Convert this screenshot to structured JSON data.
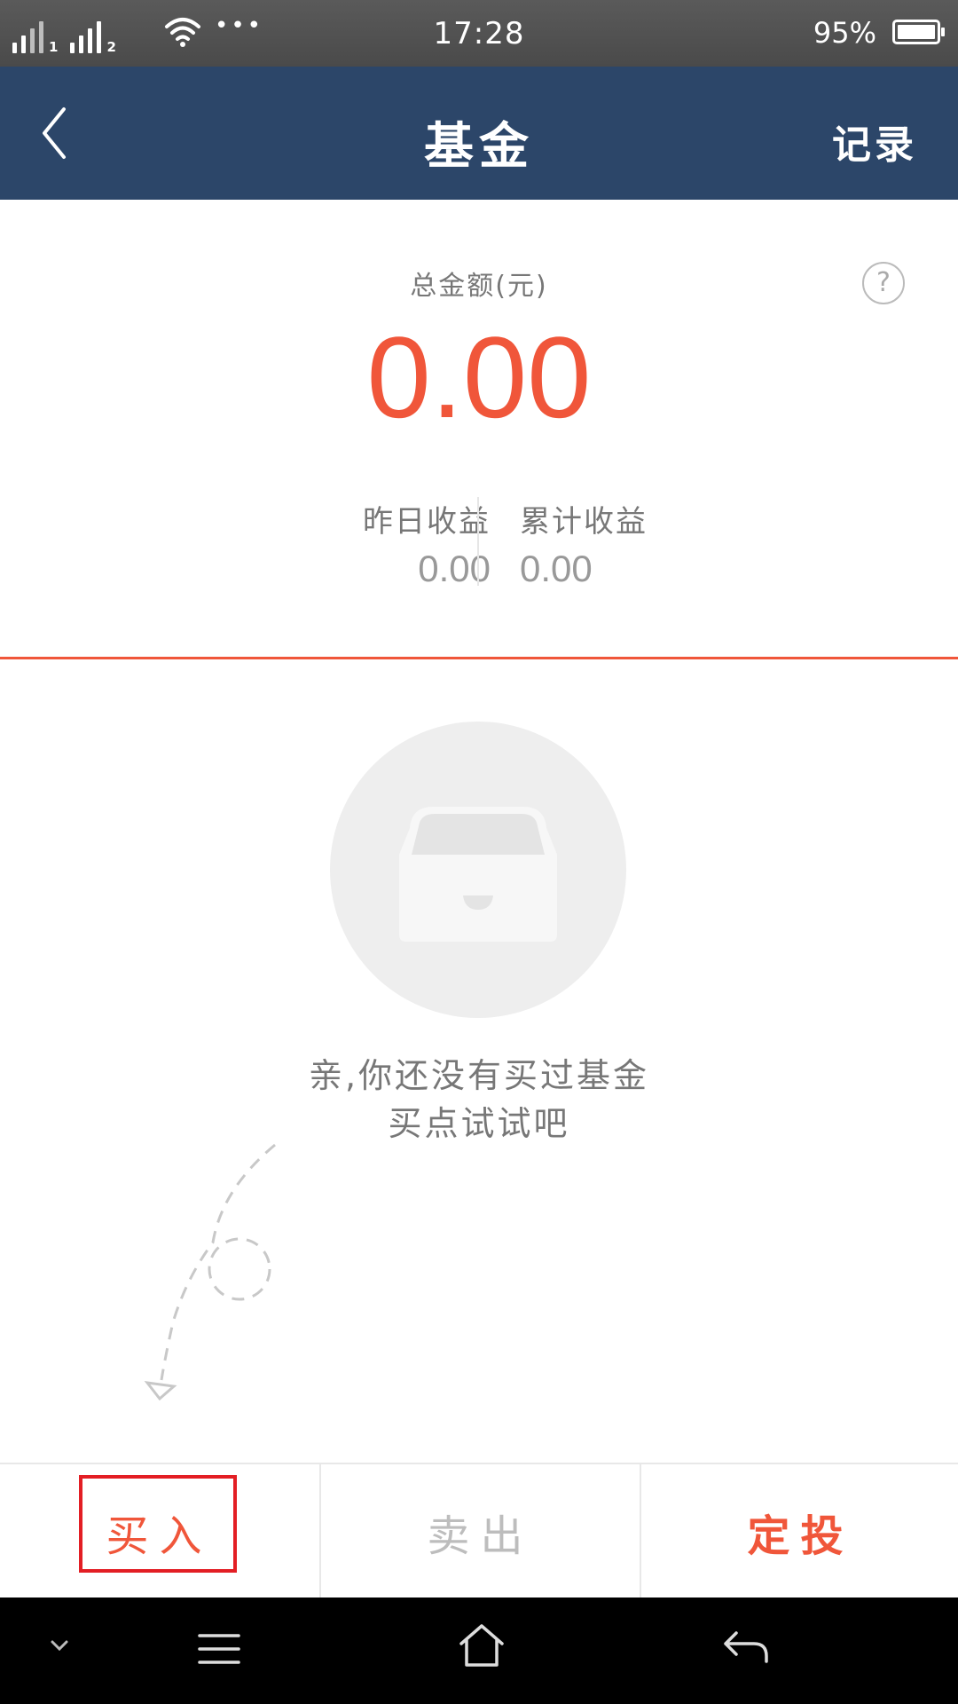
{
  "status_bar": {
    "time": "17:28",
    "battery_percent": "95%",
    "sim1": "1",
    "sim2": "2",
    "more": "•••",
    "icons": [
      "signal-icon",
      "wifi-icon",
      "battery-icon"
    ]
  },
  "nav": {
    "back_icon": "chevron-left-icon",
    "title": "基金",
    "record_label": "记录"
  },
  "summary": {
    "total_label": "总金额(元)",
    "total_amount": "0.00",
    "help_label": "?",
    "yesterday_label": "昨日收益",
    "yesterday_value": "0.00",
    "cumulative_label": "累计收益",
    "cumulative_value": "0.00"
  },
  "empty_state": {
    "icon": "empty-drawer-icon",
    "line1": "亲,你还没有买过基金",
    "line2": "买点试试吧"
  },
  "actions": {
    "buy": "买入",
    "sell": "卖出",
    "plan": "定投"
  },
  "system_nav": {
    "icons": [
      "chevron-down-icon",
      "menu-icon",
      "home-icon",
      "back-icon"
    ]
  },
  "colors": {
    "nav_bg": "#2c4669",
    "accent": "#f0563a",
    "highlight": "#e31e24"
  }
}
